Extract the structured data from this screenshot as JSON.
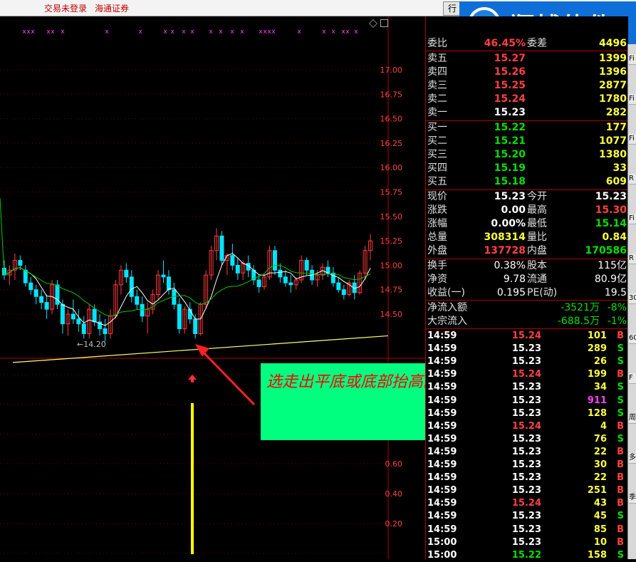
{
  "topbar": {
    "trade_status": "交易未登录",
    "broker": "海通证券",
    "menu_label": "行"
  },
  "brand": {
    "name": "翔博软件",
    "stock_tag": "L",
    "stock_code_partial": "R",
    "stock_code_line2": "30"
  },
  "chart": {
    "y_ticks": [
      "17.00",
      "16.75",
      "16.50",
      "16.25",
      "16.00",
      "15.75",
      "15.50",
      "15.25",
      "15.00",
      "14.75",
      "14.50"
    ],
    "low_label": "←14.20",
    "lower_ticks": [
      "0.60",
      "0.40",
      "0.20"
    ],
    "signal_marks": "x",
    "colors": {
      "up": "#ff3b3b",
      "down": "#00e5ff",
      "ma5": "#ffffff",
      "ma10": "#00c800",
      "support": "#ffff66",
      "grid": "#b00000"
    }
  },
  "chart_data": {
    "type": "candlestick",
    "ylim": [
      14.2,
      17.2
    ],
    "support_line": {
      "start": 14.18,
      "end": 14.38
    },
    "candles": [
      [
        14.97,
        15.05,
        14.85,
        14.9
      ],
      [
        14.9,
        15.0,
        14.8,
        14.95
      ],
      [
        14.95,
        15.12,
        14.85,
        15.05
      ],
      [
        15.05,
        15.1,
        14.95,
        15.0
      ],
      [
        14.95,
        15.0,
        14.78,
        14.82
      ],
      [
        14.82,
        14.88,
        14.7,
        14.75
      ],
      [
        14.75,
        14.8,
        14.6,
        14.68
      ],
      [
        14.68,
        14.75,
        14.55,
        14.62
      ],
      [
        14.62,
        14.7,
        14.45,
        14.55
      ],
      [
        14.55,
        14.85,
        14.5,
        14.8
      ],
      [
        14.8,
        14.85,
        14.55,
        14.6
      ],
      [
        14.6,
        14.65,
        14.3,
        14.4
      ],
      [
        14.4,
        14.55,
        14.28,
        14.5
      ],
      [
        14.5,
        14.65,
        14.4,
        14.45
      ],
      [
        14.45,
        14.55,
        14.32,
        14.4
      ],
      [
        14.4,
        14.48,
        14.25,
        14.3
      ],
      [
        14.3,
        14.6,
        14.25,
        14.55
      ],
      [
        14.55,
        14.6,
        14.38,
        14.42
      ],
      [
        14.42,
        14.5,
        14.28,
        14.35
      ],
      [
        14.35,
        14.45,
        14.22,
        14.3
      ],
      [
        14.3,
        14.55,
        14.25,
        14.48
      ],
      [
        14.48,
        14.85,
        14.45,
        14.8
      ],
      [
        14.8,
        15.0,
        14.7,
        14.95
      ],
      [
        14.95,
        15.02,
        14.82,
        14.88
      ],
      [
        14.88,
        14.95,
        14.62,
        14.68
      ],
      [
        14.68,
        14.75,
        14.55,
        14.6
      ],
      [
        14.6,
        14.68,
        14.42,
        14.48
      ],
      [
        14.48,
        14.62,
        14.3,
        14.55
      ],
      [
        14.55,
        14.75,
        14.5,
        14.7
      ],
      [
        14.7,
        14.95,
        14.65,
        14.9
      ],
      [
        14.9,
        15.05,
        14.82,
        14.88
      ],
      [
        14.88,
        14.95,
        14.7,
        14.75
      ],
      [
        14.75,
        14.82,
        14.55,
        14.6
      ],
      [
        14.6,
        14.66,
        14.3,
        14.35
      ],
      [
        14.35,
        14.58,
        14.3,
        14.55
      ],
      [
        14.55,
        14.62,
        14.4,
        14.45
      ],
      [
        14.45,
        14.5,
        14.25,
        14.3
      ],
      [
        14.3,
        14.62,
        14.28,
        14.6
      ],
      [
        14.6,
        14.95,
        14.55,
        14.9
      ],
      [
        14.9,
        15.2,
        14.85,
        15.15
      ],
      [
        15.15,
        15.38,
        15.05,
        15.3
      ],
      [
        15.3,
        15.35,
        15.0,
        15.05
      ],
      [
        15.05,
        15.12,
        14.9,
        15.1
      ],
      [
        15.1,
        15.22,
        14.95,
        15.0
      ],
      [
        15.0,
        15.08,
        14.85,
        14.92
      ],
      [
        14.92,
        15.05,
        14.85,
        15.02
      ],
      [
        15.02,
        15.1,
        14.88,
        14.95
      ],
      [
        14.95,
        15.0,
        14.8,
        14.85
      ],
      [
        14.85,
        14.9,
        14.72,
        14.78
      ],
      [
        14.78,
        14.92,
        14.75,
        14.88
      ],
      [
        14.88,
        15.2,
        14.85,
        15.15
      ],
      [
        15.15,
        15.2,
        14.9,
        14.95
      ],
      [
        14.95,
        15.02,
        14.82,
        14.88
      ],
      [
        14.88,
        14.95,
        14.78,
        14.82
      ],
      [
        14.82,
        14.9,
        14.72,
        14.8
      ],
      [
        14.8,
        14.88,
        14.75,
        14.85
      ],
      [
        14.85,
        15.1,
        14.82,
        15.05
      ],
      [
        15.05,
        15.08,
        14.9,
        14.95
      ],
      [
        14.95,
        15.0,
        14.8,
        14.85
      ],
      [
        14.85,
        14.95,
        14.78,
        14.9
      ],
      [
        14.9,
        15.02,
        14.85,
        14.98
      ],
      [
        14.98,
        15.05,
        14.88,
        14.92
      ],
      [
        14.92,
        14.98,
        14.78,
        14.82
      ],
      [
        14.82,
        14.88,
        14.72,
        14.75
      ],
      [
        14.75,
        14.8,
        14.65,
        14.7
      ],
      [
        14.7,
        14.85,
        14.68,
        14.82
      ],
      [
        14.82,
        14.9,
        14.65,
        14.72
      ],
      [
        14.72,
        14.95,
        14.7,
        14.92
      ],
      [
        14.92,
        15.2,
        14.85,
        15.15
      ],
      [
        15.15,
        15.32,
        15.05,
        15.25
      ]
    ]
  },
  "annotation": {
    "text": "选走出平底或底部抬高的票！",
    "bg_color": "#00ff7f",
    "text_color": "#ff0000"
  },
  "quote": {
    "weibi_label": "委比",
    "weibi_value": "46.45%",
    "weicha_label": "委差",
    "weicha_value": "4496",
    "sell": [
      {
        "label": "卖五",
        "price": "15.27",
        "vol": "1399"
      },
      {
        "label": "卖四",
        "price": "15.26",
        "vol": "1396"
      },
      {
        "label": "卖三",
        "price": "15.25",
        "vol": "2877"
      },
      {
        "label": "卖二",
        "price": "15.24",
        "vol": "1780"
      },
      {
        "label": "卖一",
        "price": "15.23",
        "vol": "282"
      }
    ],
    "buy": [
      {
        "label": "买一",
        "price": "15.22",
        "vol": "177"
      },
      {
        "label": "买二",
        "price": "15.21",
        "vol": "1077"
      },
      {
        "label": "买三",
        "price": "15.20",
        "vol": "1380"
      },
      {
        "label": "买四",
        "price": "15.19",
        "vol": "33"
      },
      {
        "label": "买五",
        "price": "15.18",
        "vol": "609"
      }
    ],
    "stats": [
      {
        "l1": "现价",
        "v1": "15.23",
        "c1": "#ffffff",
        "l2": "今开",
        "v2": "15.23",
        "c2": "#ffffff"
      },
      {
        "l1": "涨跌",
        "v1": "0.00",
        "c1": "#ffffff",
        "l2": "最高",
        "v2": "15.30",
        "c2": "#ff4040"
      },
      {
        "l1": "涨幅",
        "v1": "0.00%",
        "c1": "#ffffff",
        "l2": "最低",
        "v2": "15.14",
        "c2": "#00e000"
      },
      {
        "l1": "总量",
        "v1": "308314",
        "c1": "#ffff40",
        "l2": "量比",
        "v2": "0.84",
        "c2": "#ffff40"
      },
      {
        "l1": "外盘",
        "v1": "137728",
        "c1": "#ff4040",
        "l2": "内盘",
        "v2": "170586",
        "c2": "#00e000"
      }
    ],
    "stats2": [
      {
        "l1": "换手",
        "v1": "0.38%",
        "l2": "股本",
        "v2": "115亿"
      },
      {
        "l1": "净资",
        "v1": "9.78",
        "l2": "流通",
        "v2": "80.9亿"
      },
      {
        "l1": "收益(一)",
        "v1": "0.195",
        "l2": "PE(动)",
        "v2": "19.5"
      }
    ],
    "flow": [
      {
        "label": "净流入额",
        "value": "-3521万",
        "pct": "-8%"
      },
      {
        "label": "大宗流入",
        "value": "-688.5万",
        "pct": "-1%"
      }
    ],
    "ticks": [
      {
        "t": "14:59",
        "p": "15.24",
        "pc": "#ff4040",
        "v": "101",
        "vc": "#ffff40",
        "s": "B"
      },
      {
        "t": "14:59",
        "p": "15.23",
        "pc": "#ffffff",
        "v": "289",
        "vc": "#ffff40",
        "s": "S"
      },
      {
        "t": "14:59",
        "p": "15.23",
        "pc": "#ffffff",
        "v": "26",
        "vc": "#ffff40",
        "s": "S"
      },
      {
        "t": "14:59",
        "p": "15.24",
        "pc": "#ff4040",
        "v": "199",
        "vc": "#ffff40",
        "s": "B"
      },
      {
        "t": "14:59",
        "p": "15.23",
        "pc": "#ffffff",
        "v": "34",
        "vc": "#ffff40",
        "s": "S"
      },
      {
        "t": "14:59",
        "p": "15.23",
        "pc": "#ffffff",
        "v": "911",
        "vc": "#ff40ff",
        "s": "S"
      },
      {
        "t": "14:59",
        "p": "15.23",
        "pc": "#ffffff",
        "v": "128",
        "vc": "#ffff40",
        "s": "S"
      },
      {
        "t": "14:59",
        "p": "15.24",
        "pc": "#ff4040",
        "v": "4",
        "vc": "#ffff40",
        "s": "B"
      },
      {
        "t": "14:59",
        "p": "15.23",
        "pc": "#ffffff",
        "v": "76",
        "vc": "#ffff40",
        "s": "S"
      },
      {
        "t": "14:59",
        "p": "15.23",
        "pc": "#ffffff",
        "v": "22",
        "vc": "#ffff40",
        "s": "B"
      },
      {
        "t": "14:59",
        "p": "15.23",
        "pc": "#ffffff",
        "v": "30",
        "vc": "#ffff40",
        "s": "B"
      },
      {
        "t": "14:59",
        "p": "15.23",
        "pc": "#ffffff",
        "v": "22",
        "vc": "#ffff40",
        "s": "B"
      },
      {
        "t": "14:59",
        "p": "15.23",
        "pc": "#ffffff",
        "v": "251",
        "vc": "#ffff40",
        "s": "B"
      },
      {
        "t": "14:59",
        "p": "15.24",
        "pc": "#ff4040",
        "v": "43",
        "vc": "#ffff40",
        "s": "B"
      },
      {
        "t": "14:59",
        "p": "15.23",
        "pc": "#ffffff",
        "v": "45",
        "vc": "#ffff40",
        "s": "S"
      },
      {
        "t": "14:59",
        "p": "15.23",
        "pc": "#ffffff",
        "v": "85",
        "vc": "#ffff40",
        "s": "B"
      },
      {
        "t": "15:00",
        "p": "15.23",
        "pc": "#ffffff",
        "v": "10",
        "vc": "#ffff40",
        "s": "B"
      },
      {
        "t": "15:00",
        "p": "15.22",
        "pc": "#00e000",
        "v": "158",
        "vc": "#ffff40",
        "s": "S"
      }
    ]
  },
  "right_strip": [
    "Fi",
    "Fi",
    "Fi",
    "R",
    "Fi",
    "R",
    "30",
    "60",
    "F",
    "周",
    "多",
    "季"
  ]
}
